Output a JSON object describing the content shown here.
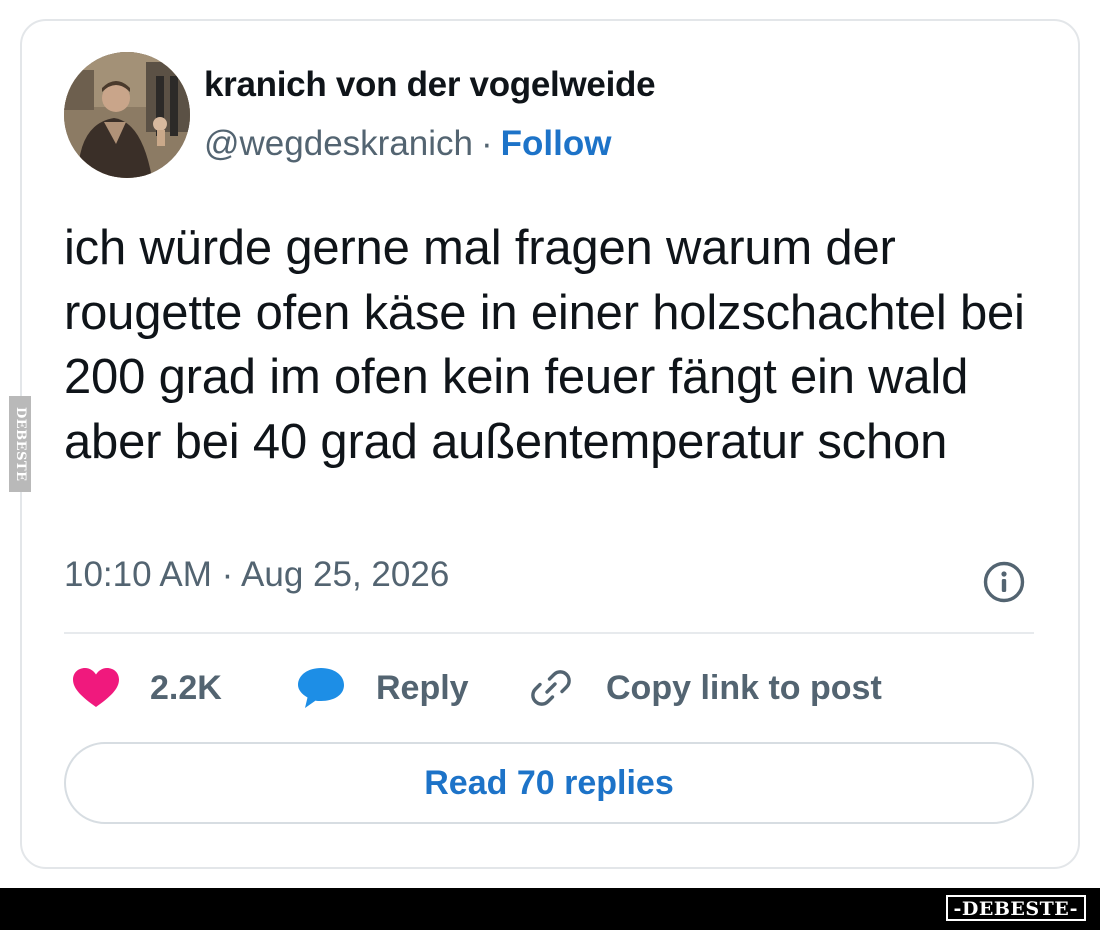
{
  "author": {
    "name": "kranich von der vogelweide",
    "handle": "@wegdeskranich",
    "separator": "·",
    "follow_label": "Follow"
  },
  "tweet": {
    "text": "ich würde gerne mal fragen warum der rougette ofen käse in einer holzschachtel bei 200 grad im ofen kein feuer fängt ein wald aber bei 40 grad außentemperatur schon",
    "timestamp": "10:10 AM · Aug 25, 2026"
  },
  "actions": {
    "like_count": "2.2K",
    "reply_label": "Reply",
    "copy_label": "Copy link to post"
  },
  "read_replies_label": "Read 70 replies",
  "icons": {
    "info": "info-icon",
    "like": "heart-icon",
    "reply": "speech-bubble-icon",
    "copy": "link-icon"
  },
  "colors": {
    "accent": "#1d73c8",
    "like": "#f0197d",
    "reply": "#1d8ee6",
    "muted": "#536471"
  },
  "watermarks": {
    "side": "DEBESTE",
    "bottom": "-DEBESTE-"
  }
}
